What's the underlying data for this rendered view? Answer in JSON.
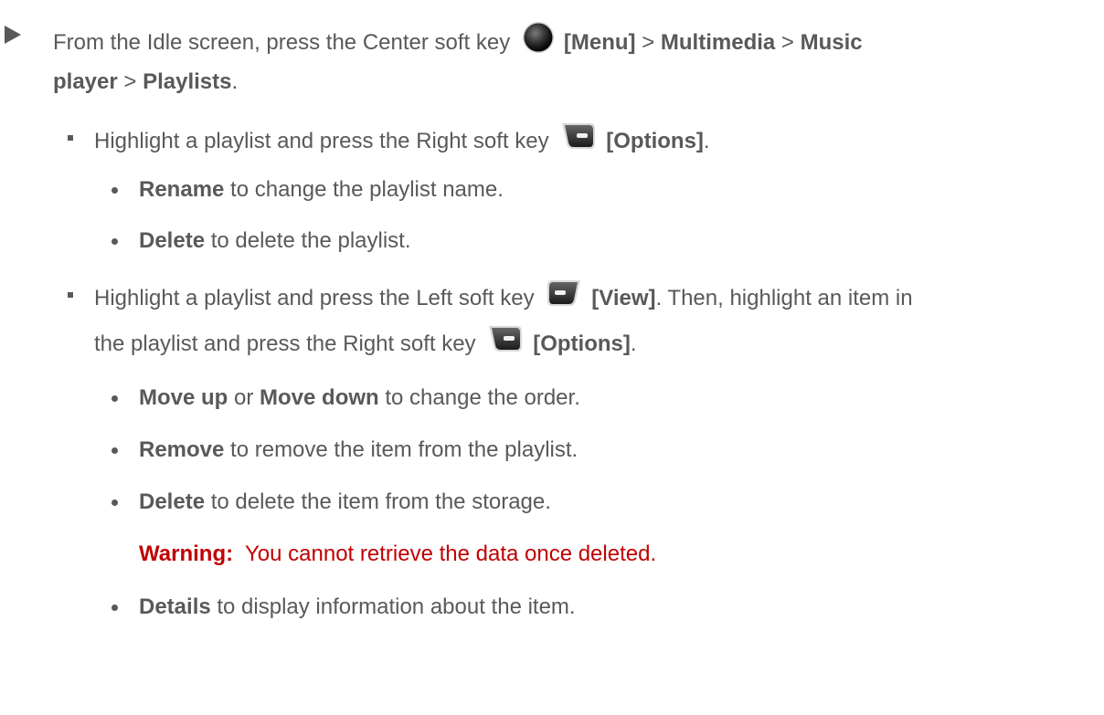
{
  "intro": {
    "t1": "From the Idle screen, press the Center soft key",
    "menu": "[Menu]",
    "sep1": ">",
    "multimedia": "Multimedia",
    "sep2": ">",
    "music": "Music",
    "player": "player",
    "sep3": ">",
    "playlists": "Playlists",
    "period": "."
  },
  "bullet1": {
    "t1": "Highlight a playlist and press the Right soft key",
    "options": "[Options]",
    "period": ".",
    "items": [
      {
        "bold": "Rename",
        "text": " to change the playlist name."
      },
      {
        "bold": "Delete",
        "text": " to delete the playlist."
      }
    ]
  },
  "bullet2": {
    "t1": "Highlight a playlist and press the Left soft key",
    "view": "[View]",
    "t2": ". Then, highlight an item in",
    "t3": "the playlist and press the Right soft key",
    "options": "[Options]",
    "period": ".",
    "items": [
      {
        "bold": "Move up",
        "mid": " or ",
        "bold2": "Move down",
        "text": " to change the order."
      },
      {
        "bold": "Remove",
        "text": " to remove the item from the playlist."
      },
      {
        "bold": "Delete",
        "text": " to delete the item from the storage."
      }
    ],
    "warning_label": "Warning:",
    "warning_text": "You cannot retrieve the data once deleted.",
    "last_item": {
      "bold": "Details",
      "text": " to display information about the item."
    }
  },
  "icons": {
    "center_key": "center-soft-key-icon",
    "right_key": "right-soft-key-icon",
    "left_key": "left-soft-key-icon"
  },
  "colors": {
    "text": "#595959",
    "warning": "#c00000"
  }
}
